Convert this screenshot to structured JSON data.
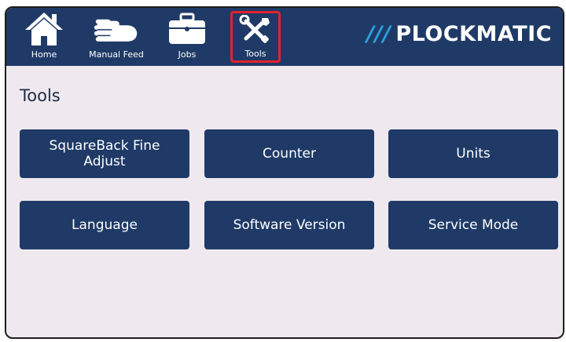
{
  "nav": {
    "items": [
      {
        "label": "Home",
        "icon": "home-icon"
      },
      {
        "label": "Manual Feed",
        "icon": "hand-icon"
      },
      {
        "label": "Jobs",
        "icon": "briefcase-icon"
      },
      {
        "label": "Tools",
        "icon": "tools-icon",
        "selected": true
      }
    ],
    "brand": {
      "slashes": "///",
      "name": "PLOCKMATIC"
    }
  },
  "main": {
    "title": "Tools",
    "tiles": [
      {
        "label": "SquareBack Fine Adjust"
      },
      {
        "label": "Counter"
      },
      {
        "label": "Units"
      },
      {
        "label": "Language"
      },
      {
        "label": "Software Version"
      },
      {
        "label": "Service Mode"
      }
    ]
  },
  "colors": {
    "bar": "#1f3a66",
    "background": "#efe9ef",
    "selection": "#e3222d",
    "brand_accent": "#2aa3e0"
  }
}
